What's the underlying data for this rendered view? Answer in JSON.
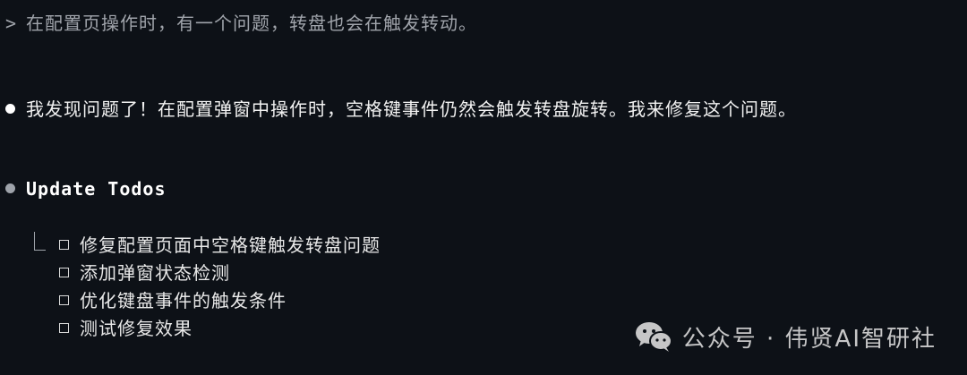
{
  "prompt": {
    "caret": ">",
    "text": "在配置页操作时，有一个问题，转盘也会在触发转动。"
  },
  "assistant_message": {
    "text": "我发现问题了！在配置弹窗中操作时，空格键事件仍然会触发转盘旋转。我来修复这个问题。"
  },
  "tool_call": {
    "title": "Update Todos"
  },
  "todos": [
    {
      "label": "修复配置页面中空格键触发转盘问题",
      "status": "pending"
    },
    {
      "label": "添加弹窗状态检测",
      "status": "pending"
    },
    {
      "label": "优化键盘事件的触发条件",
      "status": "pending"
    },
    {
      "label": "测试修复效果",
      "status": "pending"
    }
  ],
  "watermark": {
    "icon": "wechat-icon",
    "text": "公众号 · 伟贤AI智研社"
  },
  "colors": {
    "background": "#0d1117",
    "prompt_text": "#a0a4ab",
    "primary_text": "#f2f2f2",
    "muted_bullet": "#9ea3aa"
  }
}
